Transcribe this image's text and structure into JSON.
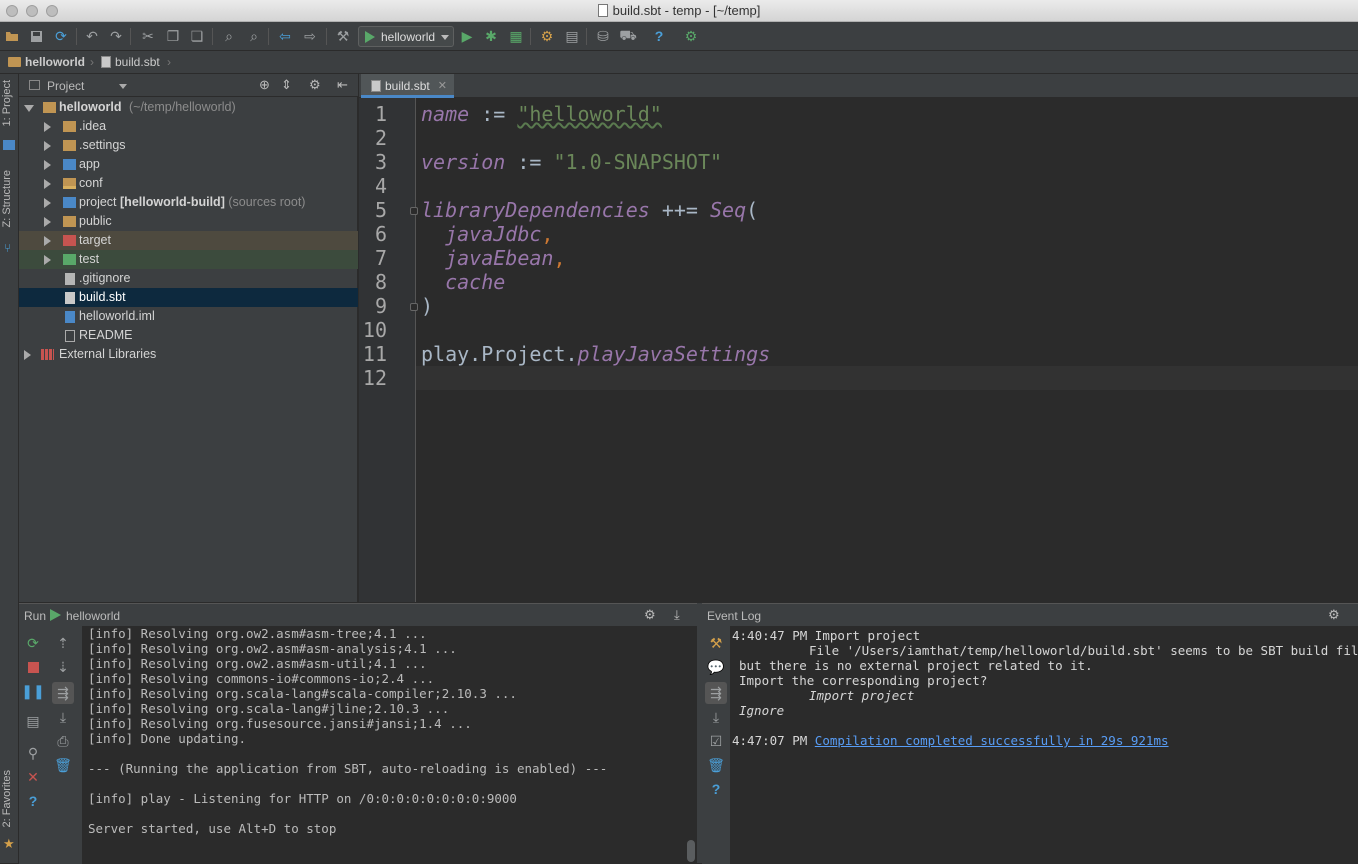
{
  "window": {
    "title": "build.sbt - temp - [~/temp]"
  },
  "toolbar": {
    "run_config": "helloworld",
    "icons": [
      "open-icon",
      "save-icon",
      "sync-icon",
      "undo-icon",
      "redo-icon",
      "cut-icon",
      "copy-icon",
      "paste-icon",
      "find-icon",
      "replace-icon",
      "back-icon",
      "forward-icon",
      "run-icon",
      "debug-icon",
      "coverage-icon",
      "settings-icon",
      "structure-icon",
      "sdk-icon",
      "android-icon",
      "help-icon",
      "plugin-icon"
    ]
  },
  "breadcrumb": {
    "project": "helloworld",
    "file": "build.sbt"
  },
  "left_strip": {
    "project_tab": "1: Project",
    "structure_tab": "Z: Structure",
    "favorites_tab": "2: Favorites"
  },
  "project_panel": {
    "header": "Project",
    "root_name": "helloworld",
    "root_path": "(~/temp/helloworld)",
    "items": [
      {
        "label": "idea"
      },
      {
        "label": ".settings"
      },
      {
        "label": "app"
      },
      {
        "label": "conf"
      },
      {
        "label": "project",
        "suffix": "[helloworld-build]",
        "note": "(sources root)"
      },
      {
        "label": "public"
      },
      {
        "label": "target"
      },
      {
        "label": "test"
      },
      {
        "label": ".gitignore"
      },
      {
        "label": "build.sbt"
      },
      {
        "label": "helloworld.iml"
      },
      {
        "label": "README"
      }
    ],
    "external": "External Libraries"
  },
  "editor": {
    "tab_label": "build.sbt",
    "line_numbers": [
      "1",
      "2",
      "3",
      "4",
      "5",
      "6",
      "7",
      "8",
      "9",
      "10",
      "11",
      "12"
    ],
    "lines": {
      "l1_kw": "name",
      "l1_op": " := ",
      "l1_str": "\"helloworld\"",
      "l3_kw": "version",
      "l3_op": " := ",
      "l3_str": "\"1.0-SNAPSHOT\"",
      "l5_kw": "libraryDependencies",
      "l5_op": " ++= ",
      "l5_fn": "Seq",
      "l5_paren": "(",
      "l6": "javaJdbc",
      "l7": "javaEbean",
      "l8": "cache",
      "comma": ",",
      "l9": ")",
      "l11_a": "play.Project.",
      "l11_b": "playJavaSettings"
    }
  },
  "run_panel": {
    "title": "Run",
    "config": "helloworld",
    "console_lines": [
      "[info] Resolving org.ow2.asm#asm-tree;4.1 ...",
      "[info] Resolving org.ow2.asm#asm-analysis;4.1 ...",
      "[info] Resolving org.ow2.asm#asm-util;4.1 ...",
      "[info] Resolving commons-io#commons-io;2.4 ...",
      "[info] Resolving org.scala-lang#scala-compiler;2.10.3 ...",
      "[info] Resolving org.scala-lang#jline;2.10.3 ...",
      "[info] Resolving org.fusesource.jansi#jansi;1.4 ...",
      "[info] Done updating.",
      "",
      "--- (Running the application from SBT, auto-reloading is enabled) ---",
      "",
      "[info] play - Listening for HTTP on /0:0:0:0:0:0:0:0:9000",
      "",
      "Server started, use Alt+D to stop"
    ]
  },
  "event_log": {
    "title": "Event Log",
    "entry1_time": "4:40:47 PM",
    "entry1_title": "Import project",
    "entry1_line1": "File '/Users/iamthat/temp/helloworld/build.sbt' seems to be SBT build file,",
    "entry1_line2": "but there is no external project related to it.",
    "entry1_line3": "Import the corresponding project?",
    "entry1_action1": "Import project",
    "entry1_action2": "Ignore",
    "entry2_time": "4:47:07 PM",
    "entry2_link": "Compilation completed successfully in 29s 921ms"
  },
  "colors": {
    "keyword": "#9876aa",
    "string": "#6a8759",
    "operator": "#cc7832",
    "selection": "#0d293e",
    "accent": "#4a88c7"
  }
}
